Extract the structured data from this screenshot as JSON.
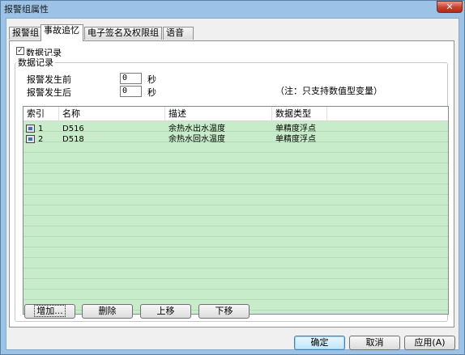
{
  "window": {
    "title": "报警组属性",
    "close_glyph": "✕"
  },
  "tabs": [
    {
      "label": "报警组",
      "active": false
    },
    {
      "label": "事故追忆",
      "active": true
    },
    {
      "label": "电子签名及权限组",
      "active": false
    },
    {
      "label": "语音",
      "active": false
    }
  ],
  "record": {
    "checkbox_label": "数据记录",
    "checked": true,
    "check_glyph": "✓",
    "group_title": "数据记录",
    "before_label": "报警发生前",
    "before_value": "0",
    "after_label": "报警发生后",
    "after_value": "0",
    "unit": "秒",
    "note": "（注：只支持数值型变量）"
  },
  "table": {
    "columns": [
      "索引",
      "名称",
      "描述",
      "数据类型"
    ],
    "rows": [
      {
        "index": "1",
        "name": "D516",
        "description": "余热水出水温度",
        "type": "单精度浮点"
      },
      {
        "index": "2",
        "name": "D518",
        "description": "余热水回水温度",
        "type": "单精度浮点"
      }
    ]
  },
  "list_buttons": {
    "add": "增加...",
    "delete": "删除",
    "up": "上移",
    "down": "下移"
  },
  "dialog_buttons": {
    "ok": "确定",
    "cancel": "取消",
    "apply": "应用(A)"
  },
  "colors": {
    "row_bg": "#c8ecc9",
    "title_bar": "#9cc3e6",
    "close_button": "#c8412d"
  }
}
